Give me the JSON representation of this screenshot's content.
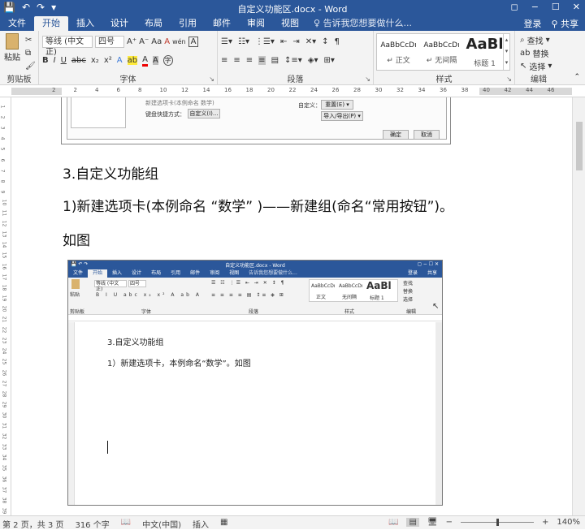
{
  "window": {
    "title": "自定义功能区.docx - Word",
    "qat": [
      "💾",
      "↶",
      "↷",
      "▾"
    ],
    "controls": [
      "◻",
      "−",
      "☐",
      "✕"
    ]
  },
  "tabs": [
    "文件",
    "开始",
    "插入",
    "设计",
    "布局",
    "引用",
    "邮件",
    "审阅",
    "视图"
  ],
  "active_tab": "开始",
  "tell_me": "告诉我您想要做什么...",
  "account": {
    "login": "登录",
    "share": "共享"
  },
  "ribbon": {
    "clipboard": {
      "name": "剪贴板",
      "paste": "粘贴"
    },
    "font": {
      "name": "字体",
      "font_name": "等线 (中文正)",
      "font_size": "四号",
      "bold": "B",
      "italic": "I",
      "underline": "U",
      "strike": "abc",
      "sub": "x₂",
      "sup": "x²",
      "grow": "A⁺",
      "shrink": "A⁻",
      "case": "Aa",
      "clear": "A",
      "wen": "wén",
      "border_a": "A",
      "highlight": "ab",
      "color": "A",
      "char_shade": "A",
      "circle": "字"
    },
    "paragraph": {
      "name": "段落"
    },
    "styles": {
      "name": "样式",
      "items": [
        {
          "preview": "AaBbCcDı",
          "label": "正文"
        },
        {
          "preview": "AaBbCcDı",
          "label": "无间隔"
        },
        {
          "preview": "AaBl",
          "label": "标题 1"
        }
      ]
    },
    "editing": {
      "name": "编辑",
      "find": "查找",
      "replace": "替换",
      "select": "选择"
    }
  },
  "ruler_numbers": [
    "2",
    "2",
    "4",
    "6",
    "8",
    "10",
    "12",
    "14",
    "16",
    "18",
    "20",
    "22",
    "24",
    "26",
    "28",
    "30",
    "32",
    "34",
    "36",
    "38",
    "40",
    "42",
    "44",
    "46"
  ],
  "vruler_numbers": [
    "1",
    "2",
    "3",
    "4",
    "5",
    "6",
    "7",
    "8",
    "9",
    "10",
    "11",
    "12",
    "13",
    "14",
    "15",
    "16",
    "17",
    "18",
    "19",
    "20",
    "21",
    "22",
    "23",
    "24",
    "25",
    "26",
    "27",
    "28",
    "29",
    "30",
    "31",
    "32",
    "33",
    "34",
    "35",
    "36",
    "37",
    "38",
    "39"
  ],
  "dialog": {
    "row1_label": "新建选项卡(本例命名 数学)",
    "keyboard_label": "键盘快捷方式：",
    "customize": "自定义(I)...",
    "custom_label": "自定义：",
    "reset": "重置(E) ▾",
    "import_export": "导入/导出(P) ▾",
    "ok": "确定",
    "cancel": "取消"
  },
  "document": {
    "heading": "3.自定义功能组",
    "line1": "1)新建选项卡(本例命名 “数学” )——新建组(命名“常用按钮”)。",
    "line2": "如图"
  },
  "embedded": {
    "title": "自定义功能区.docx - Word",
    "tabs": [
      "文件",
      "开始",
      "插入",
      "设计",
      "布局",
      "引用",
      "邮件",
      "审阅",
      "视图"
    ],
    "tell_me": "告诉我您想要做什么...",
    "account": {
      "login": "登录",
      "share": "共享"
    },
    "font_name": "等线 (中文正)",
    "font_size": "四号",
    "groups": [
      "剪贴板",
      "字体",
      "段落",
      "样式",
      "编辑"
    ],
    "styles": [
      {
        "preview": "AaBbCcDı",
        "label": "正文"
      },
      {
        "preview": "AaBbCcDı",
        "label": "无间隔"
      },
      {
        "preview": "AaBl",
        "label": "标题 1"
      }
    ],
    "editing": [
      "查找",
      "替换",
      "选择"
    ],
    "paste": "粘贴",
    "heading": "3.自定义功能组",
    "line1": "1）新建选项卡，本例命名“数学”。如图"
  },
  "status": {
    "page": "第 2 页，共 3 页",
    "words": "316 个字",
    "lang": "中文(中国)",
    "mode": "插入",
    "zoom": "140%",
    "zoom_minus": "−",
    "zoom_plus": "+"
  }
}
